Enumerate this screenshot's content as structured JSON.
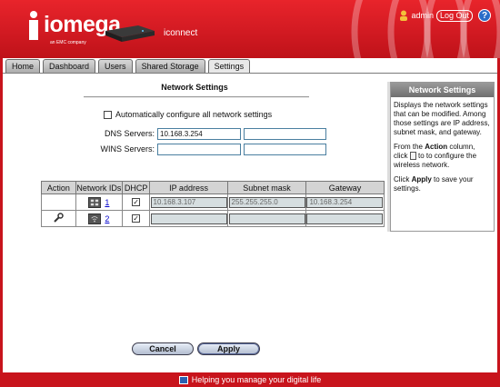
{
  "header": {
    "logo_text": "iomega",
    "logo_sub": "an EMC company",
    "device_name": "iconnect",
    "user_name": "admin",
    "logout_label": "Log Out",
    "help_label": "?"
  },
  "tabs": [
    {
      "label": "Home"
    },
    {
      "label": "Dashboard"
    },
    {
      "label": "Users"
    },
    {
      "label": "Shared Storage"
    },
    {
      "label": "Settings",
      "active": true
    }
  ],
  "network": {
    "title": "Network Settings",
    "auto_config_label": "Automatically configure all network settings",
    "dns_label": "DNS Servers:",
    "dns_value_1": "10.168.3.254",
    "dns_value_2": "",
    "wins_label": "WINS Servers:",
    "wins_value_1": "",
    "wins_value_2": ""
  },
  "table": {
    "headers": [
      "Action",
      "Network IDs",
      "DHCP",
      "IP address",
      "Subnet mask",
      "Gateway"
    ],
    "rows": [
      {
        "id": "1",
        "dhcp": true,
        "ip": "10.168.3.107",
        "subnet": "255.255.255.0",
        "gateway": "10.168.3.254",
        "icon": "ethernet-icon"
      },
      {
        "id": "2",
        "dhcp": true,
        "ip": "",
        "subnet": "",
        "gateway": "",
        "icon": "wireless-icon",
        "action_icon": "wrench-icon"
      }
    ]
  },
  "buttons": {
    "cancel": "Cancel",
    "apply": "Apply"
  },
  "help_panel": {
    "title": "Network Settings",
    "p1": "Displays the network settings that can be modified. Among those settings are IP address, subnet mask, and gateway.",
    "p2_a": "From the ",
    "p2_b": "Action",
    "p2_c": " column, click ",
    "p2_d": " to to configure the wireless network.",
    "p3_a": "Click ",
    "p3_b": "Apply",
    "p3_c": " to save your settings."
  },
  "footer": {
    "text": "Helping you manage your digital life"
  },
  "colors": {
    "brand_red": "#c8141c",
    "help_blue": "#2a6cc8"
  }
}
